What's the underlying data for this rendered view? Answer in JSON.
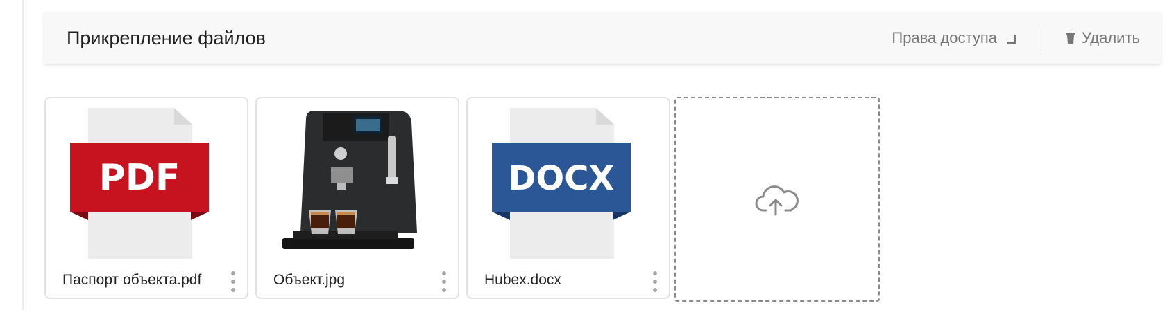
{
  "panel": {
    "title": "Прикрепление файлов",
    "access_label": "Права доступа",
    "delete_label": "Удалить"
  },
  "files": [
    {
      "name": "Паспорт объекта.pdf",
      "thumb_label": "PDF",
      "thumb_color": "#c7121f"
    },
    {
      "name": "Объект.jpg"
    },
    {
      "name": "Hubex.docx",
      "thumb_label": "DOCX",
      "thumb_color": "#2b5797"
    }
  ],
  "upload": {
    "icon": "cloud-upload-icon"
  }
}
